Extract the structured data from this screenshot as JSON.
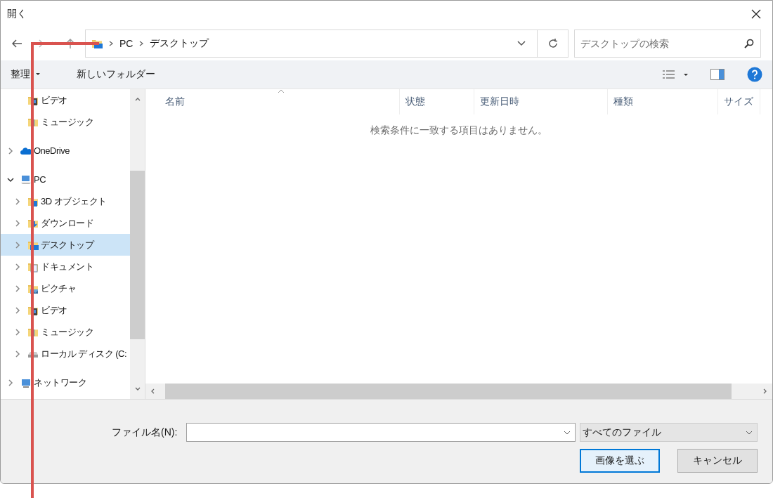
{
  "window": {
    "title": "開く"
  },
  "address_bar": {
    "path": [
      "PC",
      "デスクトップ"
    ]
  },
  "search": {
    "placeholder": "デスクトップの検索"
  },
  "toolbar": {
    "organize": "整理",
    "new_folder": "新しいフォルダー"
  },
  "nav_tree": {
    "scrolled_children": [
      {
        "label": "ビデオ",
        "kind": "video"
      },
      {
        "label": "ミュージック",
        "kind": "music"
      }
    ],
    "items": [
      {
        "label": "OneDrive",
        "kind": "cloud",
        "expanded": false,
        "selected": false
      },
      {
        "label": "PC",
        "kind": "pc",
        "expanded": true,
        "selected": false,
        "children": [
          {
            "label": "3D オブジェクト",
            "kind": "cube",
            "expanded": false,
            "selected": false
          },
          {
            "label": "ダウンロード",
            "kind": "download",
            "expanded": false,
            "selected": false
          },
          {
            "label": "デスクトップ",
            "kind": "desktop",
            "expanded": false,
            "selected": true
          },
          {
            "label": "ドキュメント",
            "kind": "document",
            "expanded": false,
            "selected": false
          },
          {
            "label": "ピクチャ",
            "kind": "picture",
            "expanded": false,
            "selected": false
          },
          {
            "label": "ビデオ",
            "kind": "video",
            "expanded": false,
            "selected": false
          },
          {
            "label": "ミュージック",
            "kind": "music",
            "expanded": false,
            "selected": false
          },
          {
            "label": "ローカル ディスク (C:",
            "kind": "disk",
            "expanded": false,
            "selected": false
          }
        ]
      },
      {
        "label": "ネットワーク",
        "kind": "network",
        "expanded": false,
        "selected": false
      }
    ]
  },
  "file_list": {
    "columns": [
      "名前",
      "状態",
      "更新日時",
      "種類",
      "サイズ"
    ],
    "empty_message": "検索条件に一致する項目はありません。"
  },
  "footer": {
    "file_name_label": "ファイル名(N):",
    "file_type": "すべてのファイル",
    "buttons": [
      {
        "label": "画像を選ぶ",
        "kind": "primary"
      },
      {
        "label": "キャンセル",
        "kind": "secondary"
      }
    ]
  }
}
